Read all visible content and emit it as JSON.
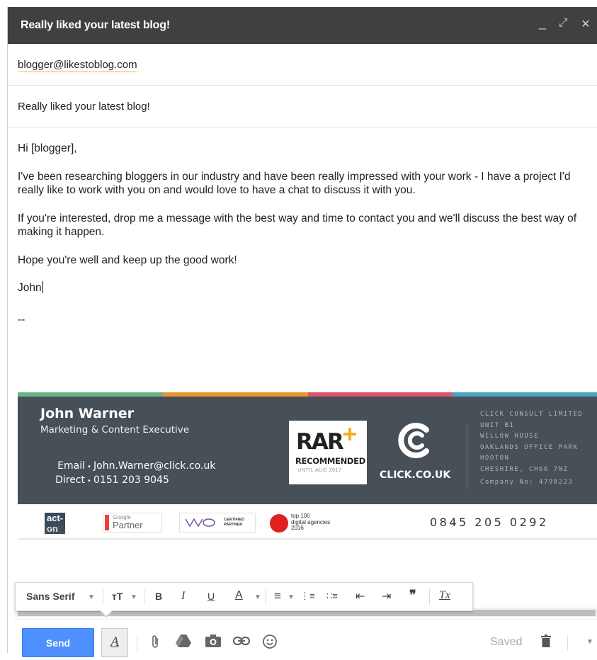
{
  "window": {
    "title": "Really liked your latest blog!",
    "controls": {
      "minimize": "_",
      "expand": "⤢",
      "close": "✕"
    }
  },
  "to": {
    "recipient": "blogger@likestoblog.com"
  },
  "subject": {
    "value": "Really liked your latest blog!"
  },
  "body": {
    "greeting": "Hi [blogger],",
    "para1": "I've been researching bloggers in our industry and have been really impressed with your work - I have a project I'd really like to work with you on and would love to have a chat to discuss it with you.",
    "para2": "If you're interested, drop me a message with the best way and time to contact you and we'll discuss the best way of making it happen.",
    "para3": "Hope you're well and keep up the good work!",
    "signoff": "John",
    "sig_separator": "--"
  },
  "signature": {
    "stripe_colors": [
      "#64b685",
      "#e8962e",
      "#dc5765",
      "#4aa3c0"
    ],
    "panel_color": "#474f57",
    "name": "John Warner",
    "role": "Marketing & Content Executive",
    "email_label": "Email",
    "email": "John.Warner@click.co.uk",
    "direct_label": "Direct",
    "direct": "0151 203 9045",
    "rar_badge": {
      "big": "RAR",
      "recommended": "RECOMMENDED",
      "until": "UNTIL AUG 2017"
    },
    "brand": "CLICK.CO.UK",
    "address": [
      "CLICK CONSULT LIMITED",
      "UNIT B1",
      "WILLOW HOUSE",
      "OAKLANDS OFFICE PARK",
      "HOOTON",
      "CHESHIRE, CH66 7NZ",
      "Company No: 4798223"
    ],
    "partners": {
      "acton_main": "act-on",
      "acton_sub": "AGENCY PARTNER",
      "google_small": "Google",
      "google_big": "Partner",
      "woo_line1": "CERTIFIED",
      "woo_line2": "PARTNER",
      "top100_line1": "top 100",
      "top100_line2": "digital agencies",
      "top100_line3": "2016"
    },
    "phone": "0845 205 0292"
  },
  "format_toolbar": {
    "font": "Sans Serif",
    "size_icon": "тT",
    "bold": "B",
    "italic": "I",
    "underline": "U",
    "text_color": "A",
    "align_icon": "≡",
    "numbered_list_icon": "⋮≡",
    "bulleted_list_icon": "∷≡",
    "indent_less_icon": "⇤",
    "indent_more_icon": "⇥",
    "quote_icon": "❞",
    "remove_format": "Tx"
  },
  "bottom_toolbar": {
    "send_label": "Send",
    "format_toggle": "A",
    "status": "Saved",
    "accent_color": "#4d90fe"
  }
}
